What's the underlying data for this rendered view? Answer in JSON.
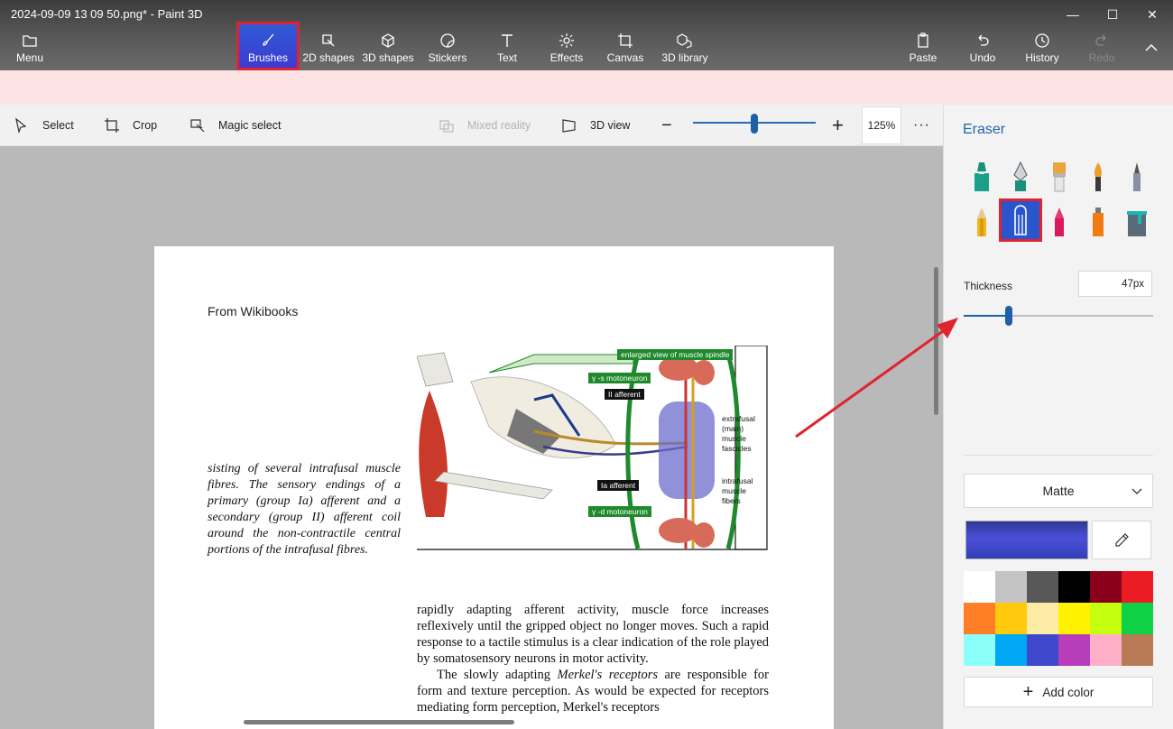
{
  "window": {
    "title": "2024-09-09 13 09 50.png* - Paint 3D",
    "minimize": "—",
    "maximize": "☐",
    "close": "✕"
  },
  "toolbar": {
    "menu": "Menu",
    "tools": [
      "Brushes",
      "2D shapes",
      "3D shapes",
      "Stickers",
      "Text",
      "Effects",
      "Canvas",
      "3D library"
    ],
    "paste": "Paste",
    "undo": "Undo",
    "history": "History",
    "redo": "Redo"
  },
  "subbar": {
    "select": "Select",
    "crop": "Crop",
    "magic_select": "Magic select",
    "mixed_reality": "Mixed reality",
    "view3d": "3D view",
    "zoom": "125%",
    "zoom_fraction": 0.5,
    "more": "···"
  },
  "document": {
    "heading": "From Wikibooks",
    "italic_text": "sisting of several intrafusal muscle fibres. The sensory endings of a primary (group Ia) afferent and a secondary (group II) afferent coil around the non-contractile central portions of the intrafusal fibres.",
    "body_p1": "rapidly adapting afferent activity, muscle force increases reflexively until the gripped object no longer moves. Such a rapid response to a tactile stimulus is a clear indication of the role played by somatosensory neurons in motor activity.",
    "body_p2_pre": "The slowly adapting ",
    "body_p2_em": "Merkel's receptors",
    "body_p2_post": " are responsible for form and texture perception. As would be expected for receptors mediating form perception, Merkel's receptors",
    "figure": {
      "enlarged": "enlarged view of muscle spindle",
      "gamma_s": "γ -s motoneuron",
      "ii_afferent": "II afferent",
      "ia_afferent": "Ia afferent",
      "gamma_d": "γ -d motoneuron",
      "extrafusal": "extrafusal (main) muscle fascicles",
      "intrafusal": "intrafusal muscle fibers"
    }
  },
  "panel": {
    "title": "Eraser",
    "brushes": [
      "marker",
      "calligraphy-pen",
      "oil-brush",
      "watercolor",
      "pixel-pen",
      "pencil",
      "eraser",
      "crayon",
      "spray-can",
      "fill"
    ],
    "selected_brush": "eraser",
    "thickness_label": "Thickness",
    "thickness_value": "47px",
    "thickness_fraction": 0.24,
    "finish": "Matte",
    "current_color": "#3b45c8",
    "add_color": "Add color",
    "palette": [
      "#ffffff",
      "#c3c3c3",
      "#585858",
      "#000000",
      "#88001b",
      "#ec1c24",
      "#ff7f27",
      "#ffc90e",
      "#fdeca6",
      "#fff200",
      "#c4ff0e",
      "#0ed145",
      "#8cfffb",
      "#00a8f3",
      "#3f48cc",
      "#b83dba",
      "#ffaec8",
      "#b97a56"
    ]
  },
  "colors": {
    "accent": "#1f66b1",
    "highlight": "#e0242f"
  }
}
